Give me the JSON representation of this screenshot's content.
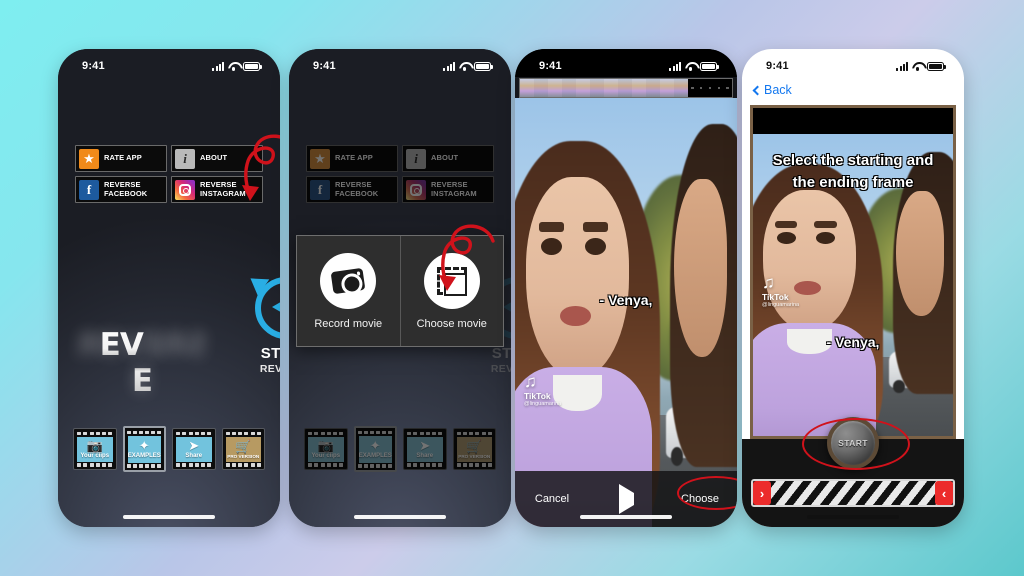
{
  "meta": {
    "background_colors": [
      "#7eeef0",
      "#ccccea",
      "#5cc8cc"
    ],
    "accent_red": "#d0121b",
    "accent_cyan": "#29aee4"
  },
  "status_bar": {
    "time": "9:41",
    "icons": [
      "signal-bars",
      "wifi",
      "battery"
    ]
  },
  "screen1": {
    "menu": [
      {
        "label": "RATE APP",
        "icon": "star-icon"
      },
      {
        "label": "ABOUT",
        "icon": "info-icon"
      },
      {
        "label": "REVERSE\nFACEBOOK",
        "line1": "REVERSE",
        "line2": "FACEBOOK",
        "icon": "facebook-icon"
      },
      {
        "label": "REVERSE\nINSTAGRAM",
        "line1": "REVERSE",
        "line2": "INSTAGRAM",
        "icon": "instagram-icon"
      }
    ],
    "logo": "REVERSE",
    "start": {
      "title": "START",
      "subtitle": "REVERSE",
      "icon": "reverse-circle-icon"
    },
    "toolbar": [
      {
        "label": "Your clips",
        "icon": "photos-icon",
        "selected": false,
        "style": "blue"
      },
      {
        "label": "EXAMPLES",
        "icon": "magic-wand-icon",
        "selected": true,
        "style": "blue"
      },
      {
        "label": "Share",
        "icon": "share-icon",
        "selected": false,
        "style": "blue"
      },
      {
        "label": "PRO VERSION",
        "icon": "cart-icon",
        "selected": false,
        "style": "gold"
      }
    ]
  },
  "screen2": {
    "dialog": [
      {
        "label": "Record movie",
        "icon": "camera-icon"
      },
      {
        "label": "Choose movie",
        "icon": "gallery-icon"
      }
    ],
    "annotation": "red-arrow-to-choose-movie"
  },
  "screen3": {
    "filmstrip": "video-thumbnail-scrubber",
    "caption": "- Venya,",
    "watermark": {
      "name": "TikTok",
      "handle": "@linguamarina"
    },
    "controls": {
      "cancel": "Cancel",
      "play": "play-icon",
      "choose": "Choose"
    },
    "annotation": "red-ellipse-around-choose"
  },
  "screen4": {
    "nav": {
      "back": "Back"
    },
    "overlay_line1": "Select the starting and",
    "overlay_line2": "the ending frame",
    "caption": "- Venya,",
    "watermark": {
      "name": "TikTok",
      "handle": "@linguamarina"
    },
    "start_button": "START",
    "trim": {
      "left_handle": "›",
      "right_handle": "‹"
    },
    "annotation": "red-ellipse-around-start"
  }
}
